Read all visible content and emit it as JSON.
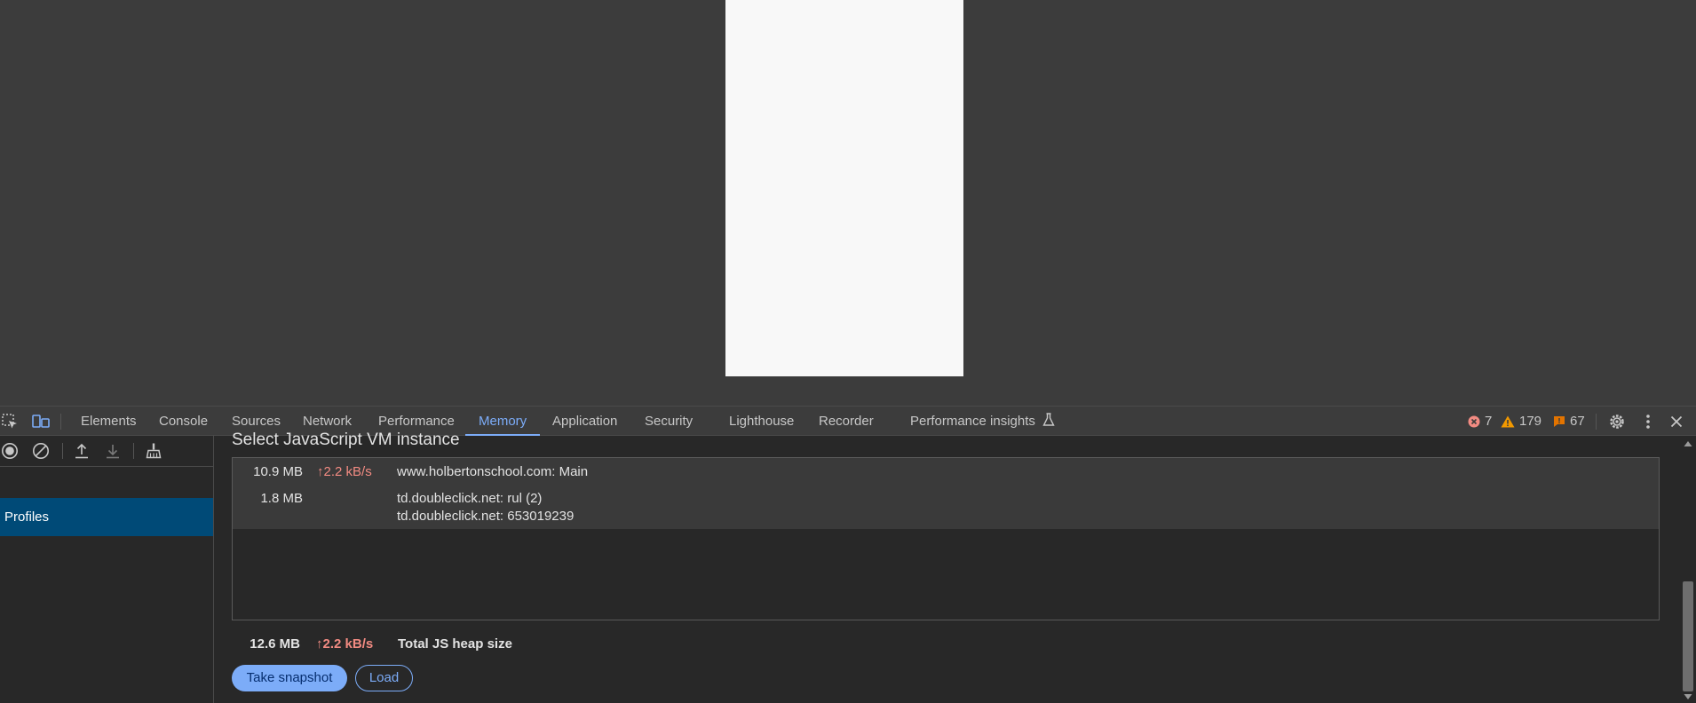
{
  "tabs": [
    {
      "label": "Elements"
    },
    {
      "label": "Console"
    },
    {
      "label": "Sources"
    },
    {
      "label": "Network"
    },
    {
      "label": "Performance"
    },
    {
      "label": "Memory",
      "active": true
    },
    {
      "label": "Application"
    },
    {
      "label": "Security"
    },
    {
      "label": "Lighthouse"
    },
    {
      "label": "Recorder"
    },
    {
      "label": "Performance insights"
    }
  ],
  "status": {
    "errors": "7",
    "warnings": "179",
    "issues": "67",
    "colors": {
      "error": "#f28b82",
      "warning": "#f29900",
      "issue": "#e37400"
    }
  },
  "sidebar": {
    "profiles_label": "Profiles"
  },
  "main": {
    "heading": "Select JavaScript VM instance",
    "instances": [
      {
        "size": "10.9 MB",
        "rate": "↑2.2 kB/s",
        "names": [
          "www.holbertonschool.com: Main"
        ]
      },
      {
        "size": "1.8 MB",
        "rate": "",
        "names": [
          "td.doubleclick.net: rul (2)",
          "td.doubleclick.net: 653019239"
        ]
      }
    ],
    "total": {
      "size": "12.6 MB",
      "rate": "↑2.2 kB/s",
      "label": "Total JS heap size"
    },
    "take_snapshot_label": "Take snapshot",
    "load_label": "Load"
  },
  "accent_color": "#7cacf8",
  "selected_bg": "#004a77"
}
